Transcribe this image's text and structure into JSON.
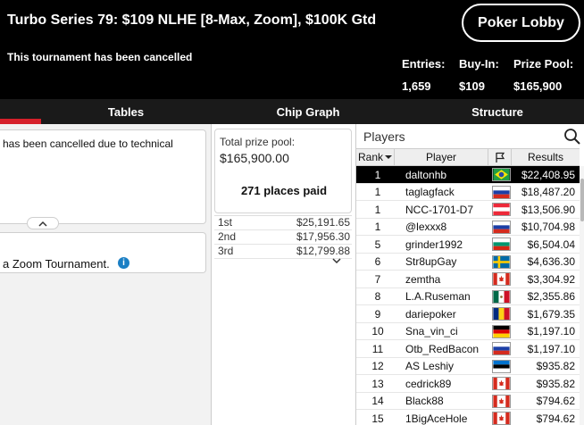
{
  "header": {
    "title": "Turbo Series 79: $109 NLHE [8-Max, Zoom], $100K Gtd",
    "cancel_note": "This tournament has been cancelled",
    "lobby_button": "Poker Lobby",
    "stats": {
      "entries_label": "Entries:",
      "entries_value": "1,659",
      "buyin_label": "Buy-In:",
      "buyin_value": "$109",
      "prize_label": "Prize Pool:",
      "prize_value": "$165,900"
    }
  },
  "tabs": {
    "tables": "Tables",
    "chip_graph": "Chip Graph",
    "structure": "Structure"
  },
  "left": {
    "message": "has been cancelled due to technical",
    "zoom_text": "a Zoom Tournament.",
    "info_icon": "i"
  },
  "prize": {
    "pool_label": "Total prize pool:",
    "pool_value": "$165,900.00",
    "places_paid": "271 places paid",
    "payouts": [
      {
        "place": "1st",
        "amount": "$25,191.65"
      },
      {
        "place": "2nd",
        "amount": "$17,956.30"
      },
      {
        "place": "3rd",
        "amount": "$12,799.88"
      }
    ]
  },
  "players": {
    "title": "Players",
    "columns": {
      "rank": "Rank",
      "player": "Player",
      "results": "Results"
    },
    "rows": [
      {
        "rank": "1",
        "name": "daltonhb",
        "flag": "brazil-flag",
        "result": "$22,408.95"
      },
      {
        "rank": "1",
        "name": "taglagfack",
        "flag": "russia-flag",
        "result": "$18,487.20"
      },
      {
        "rank": "1",
        "name": "NCC-1701-D7",
        "flag": "austria-flag",
        "result": "$13,506.90"
      },
      {
        "rank": "1",
        "name": "@lexxx8",
        "flag": "russia-flag",
        "result": "$10,704.98"
      },
      {
        "rank": "5",
        "name": "grinder1992",
        "flag": "bulgaria-flag",
        "result": "$6,504.04"
      },
      {
        "rank": "6",
        "name": "Str8upGay",
        "flag": "sweden-flag",
        "result": "$4,636.30"
      },
      {
        "rank": "7",
        "name": "zemtha",
        "flag": "canada-flag",
        "result": "$3,304.92"
      },
      {
        "rank": "8",
        "name": "L.A.Ruseman",
        "flag": "mexico-flag",
        "result": "$2,355.86"
      },
      {
        "rank": "9",
        "name": "dariepoker",
        "flag": "romania-flag",
        "result": "$1,679.35"
      },
      {
        "rank": "10",
        "name": "Sna_vin_ci",
        "flag": "germany-flag",
        "result": "$1,197.10"
      },
      {
        "rank": "11",
        "name": "Otb_RedBacon",
        "flag": "russia-flag",
        "result": "$1,197.10"
      },
      {
        "rank": "12",
        "name": "AS Leshiy",
        "flag": "estonia-flag",
        "result": "$935.82"
      },
      {
        "rank": "13",
        "name": "cedrick89",
        "flag": "canada-flag",
        "result": "$935.82"
      },
      {
        "rank": "14",
        "name": "Black88",
        "flag": "canada-flag",
        "result": "$794.62"
      },
      {
        "rank": "15",
        "name": "1BigAceHole",
        "flag": "canada-flag",
        "result": "$794.62"
      }
    ]
  },
  "colors": {
    "accent": "#d6202a",
    "header_bg": "#000000",
    "tabbar_bg": "#1a1a1a",
    "info_blue": "#1b7fc4"
  }
}
